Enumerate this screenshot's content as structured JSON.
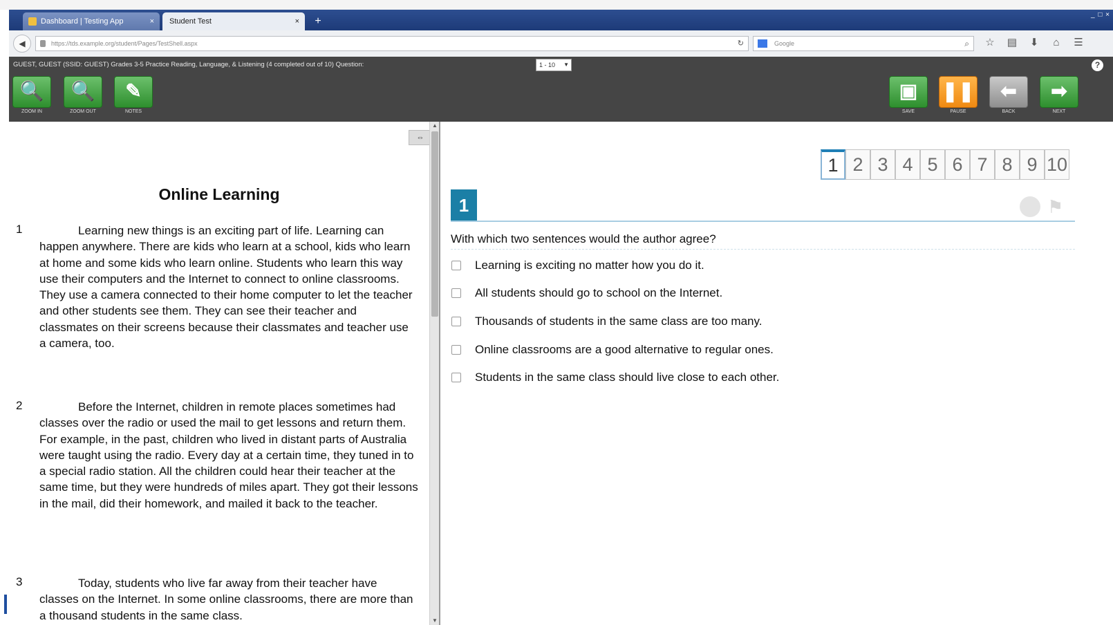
{
  "browser": {
    "tabs": [
      {
        "label": "Dashboard | Testing App",
        "close": "×"
      },
      {
        "label": "Student Test",
        "close": "×"
      }
    ],
    "new_tab": "+",
    "window_controls": "_ □ ×",
    "back": "◀",
    "url": "https://tds.example.org/student/Pages/TestShell.aspx",
    "reload": "↻",
    "search_placeholder": "Google",
    "search_icon": "⌕",
    "nav_icons": [
      "☆",
      "▤",
      "⬇",
      "⌂",
      "☰"
    ]
  },
  "header": {
    "test_info": "GUEST, GUEST (SSID: GUEST)  Grades 3-5 Practice Reading, Language, & Listening (4 completed out of 10)   Question:",
    "question_select": "1 - 10",
    "help": "?",
    "tools": [
      {
        "label": "ZOOM IN",
        "glyph": "🔍"
      },
      {
        "label": "ZOOM OUT",
        "glyph": "🔍"
      },
      {
        "label": "NOTES",
        "glyph": "✎"
      }
    ],
    "right_tools": [
      {
        "label": "SAVE",
        "glyph": "▣"
      },
      {
        "label": "PAUSE",
        "glyph": "❚❚"
      },
      {
        "label": "BACK",
        "glyph": "⬅"
      },
      {
        "label": "NEXT",
        "glyph": "➡"
      }
    ]
  },
  "passage": {
    "expand": "⇔",
    "title": "Online Learning",
    "paragraphs": [
      {
        "num": "1",
        "text": "Learning new things is an exciting part of life. Learning can happen anywhere. There are kids who learn at a school, kids who learn at home and some kids who learn online. Students who learn this way use their computers and the Internet to connect to online classrooms. They use a camera connected to their home computer to let the teacher and other students see them. They can see their teacher and classmates on their screens because their classmates and teacher use a camera, too."
      },
      {
        "num": "2",
        "text": "Before the Internet, children in remote places sometimes had classes over the radio or used the mail to get lessons and return them. For example, in the past, children who lived in distant parts of Australia were taught using the radio. Every day at a certain time, they tuned in to a special radio station. All the children could hear their teacher at the same time, but they were hundreds of miles apart. They got their lessons in the mail, did their homework, and mailed it back to the teacher."
      },
      {
        "num": "3",
        "text": "Today, students who live far away from their teacher have classes on the Internet. In some online classrooms, there are more than a thousand students in the same class."
      }
    ]
  },
  "question": {
    "nav": [
      "1",
      "2",
      "3",
      "4",
      "5",
      "6",
      "7",
      "8",
      "9",
      "10"
    ],
    "active_index": 0,
    "number": "1",
    "flag": "⚑",
    "stem": "With which two sentences would the author agree?",
    "options": [
      "Learning is exciting no matter how you do it.",
      "All students should go to school on the Internet.",
      "Thousands of students in the same class are too many.",
      "Online classrooms are a good alternative to regular ones.",
      "Students in the same class should live close to each other."
    ]
  },
  "colors": {
    "accent_blue": "#1b7fa6",
    "tool_green": "#2e8f2e",
    "pause_orange": "#ef8a12",
    "header_bg": "#454545"
  }
}
